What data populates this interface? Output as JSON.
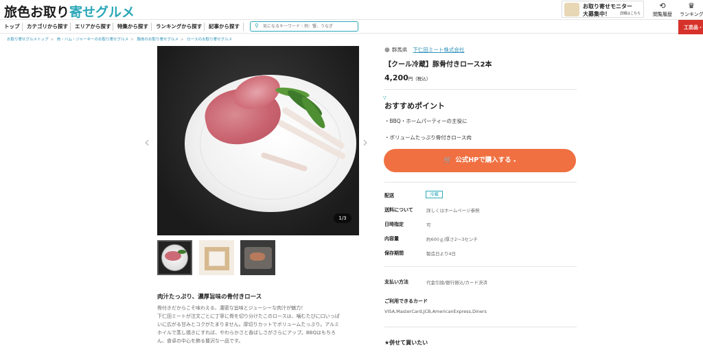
{
  "header": {
    "logo_text_a": "旅色お取り",
    "logo_text_b": "寄せグルメ",
    "promo_line1": "お取り寄せモニター",
    "promo_line2": "大募集中！",
    "promo_link": "詳細はこちら",
    "history_label": "閲覧履歴",
    "ranking_label": "ランキング"
  },
  "nav": {
    "items": [
      "トップ",
      "カテゴリから探す",
      "エリアから探す",
      "特集から探す",
      "ランキングから探す",
      "記事から探す"
    ],
    "search_placeholder": "気になるキーワード｜例：蟹、うなぎ",
    "red_tab": "工芸品・雑"
  },
  "breadcrumbs": [
    "お取り寄せグルメトップ",
    "肉・ハム・ジャーキーのお取り寄せグルメ",
    "豚肉のお取り寄せグルメ",
    "ロースのお取り寄せグルメ"
  ],
  "gallery": {
    "counter": "1/3"
  },
  "product": {
    "prefecture": "群馬県",
    "maker": "下仁田ミート株式会社",
    "title": "【クール冷蔵】豚骨付きロース2本",
    "price": "4,200",
    "price_unit": "円",
    "tax": "（税込）"
  },
  "recommend": {
    "title": "おすすめポイント",
    "points": [
      "・BBQ・ホームパーティーの主役に",
      "・ボリュームたっぷり骨付きロース肉"
    ]
  },
  "buy_button": "公式HPで購入する",
  "specs": {
    "delivery_label": "配送",
    "delivery_value": "冷蔵",
    "shipping_label": "送料について",
    "shipping_value": "詳しくはホームページ参照",
    "date_label": "日時指定",
    "date_value": "可",
    "content_label": "内容量",
    "content_value": "約600ｇ/厚さ2〜3センチ",
    "storage_label": "保存期間",
    "storage_value": "製造日より4日",
    "payment_label": "支払い方法",
    "payment_value": "代金引換/銀行振込/カード決済"
  },
  "cards": {
    "title": "ご利用できるカード",
    "value": "VISA,MasterCard,JCB,AmericanExpress,Diners"
  },
  "also_buy": "★併せて買いたい",
  "description": {
    "title": "肉汁たっぷり、濃厚旨味の骨付きロース",
    "lines": [
      "骨付きだからこそ味わえる、濃密な旨味とジューシーな肉汁が魅力！",
      "下仁田ミートが注文ごとに丁寧に骨を切り分けたこのロースは、噛むたびに口いっぱ",
      "いに広がる甘みとコクがたまりません。厚切りカットでボリュームたっぷり。アルミ",
      "ホイルで蒸し焼きにすれば、やわらかさと香ばしさがさらにアップ。BBQはもちろ",
      "ん、食卓の中心を飾る贅沢な一品です。"
    ]
  },
  "icons": {
    "search": "search-icon",
    "history": "clock-icon",
    "ranking": "crown-icon",
    "location": "pin-icon",
    "cart": "cart-icon"
  },
  "colors": {
    "accent": "#2aa7b8",
    "buy_button": "#f07042",
    "red_tab": "#d7322a"
  }
}
